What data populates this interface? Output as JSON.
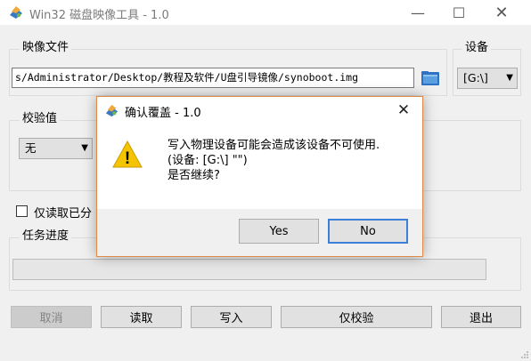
{
  "window": {
    "title": "Win32 磁盘映像工具 - 1.0",
    "min_glyph": "—",
    "max_glyph": "☐",
    "close_glyph": "✕"
  },
  "image_file": {
    "label": "映像文件",
    "path": "s/Administrator/Desktop/教程及软件/U盘引导镜像/synoboot.img"
  },
  "device": {
    "label": "设备",
    "value": "[G:\\]",
    "arrow": "▼"
  },
  "checksum": {
    "label": "校验值",
    "value": "无",
    "arrow": "▼"
  },
  "read_only": {
    "label": "仅读取已分",
    "checked": false
  },
  "progress": {
    "label": "任务进度",
    "fraction": 0
  },
  "buttons": {
    "cancel": "取消",
    "read": "读取",
    "write": "写入",
    "verify_only": "仅校验",
    "exit": "退出"
  },
  "dialog": {
    "title": "确认覆盖 - 1.0",
    "close_glyph": "✕",
    "warning_glyph": "!",
    "line1": "写入物理设备可能会造成该设备不可使用.",
    "line2": "(设备: [G:\\] \"\")",
    "line3": "是否继续?",
    "yes": "Yes",
    "no": "No"
  },
  "colors": {
    "accent_border": "#e08a4a",
    "default_button_border": "#3c7fd8",
    "warning_yellow": "#f5c400"
  }
}
